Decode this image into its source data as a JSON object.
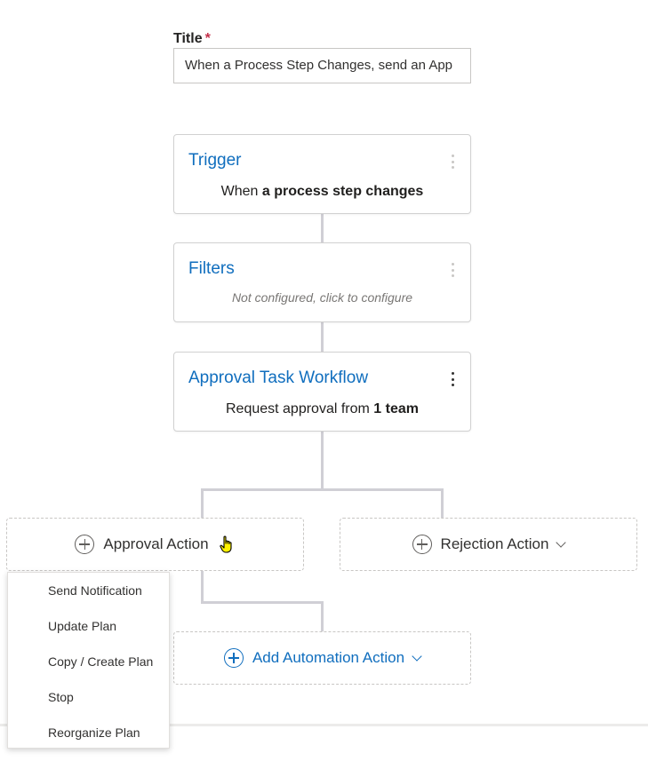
{
  "form": {
    "title_label": "Title",
    "required_mark": "*",
    "title_value": "When a Process Step Changes, send an App"
  },
  "trigger": {
    "title": "Trigger",
    "prefix": "When ",
    "bold": "a process step changes"
  },
  "filters": {
    "title": "Filters",
    "status": "Not configured, click to configure"
  },
  "approval_workflow": {
    "title": "Approval Task Workflow",
    "prefix": "Request approval from ",
    "bold": "1 team"
  },
  "branches": {
    "approval": "Approval Action",
    "rejection": "Rejection Action",
    "add_automation": "Add Automation Action"
  },
  "approval_menu": {
    "items": [
      "Send Notification",
      "Update Plan",
      "Copy / Create Plan",
      "Stop",
      "Reorganize Plan"
    ]
  },
  "colors": {
    "accent": "#106ebe",
    "required": "#c4314b",
    "connector": "#d0cfd5"
  }
}
